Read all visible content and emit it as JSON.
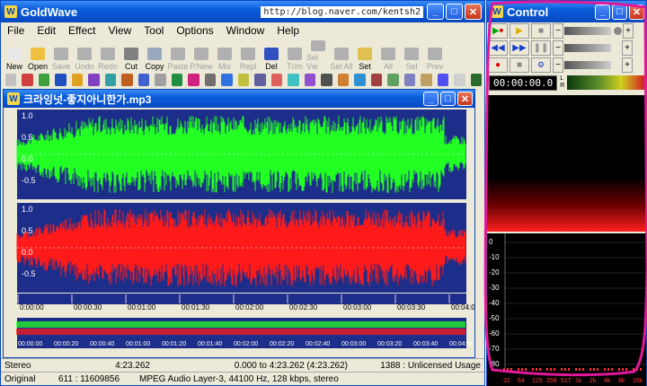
{
  "main_window": {
    "title": "GoldWave",
    "url_overlay": "http://blog.naver.com/kentsh2",
    "menu": [
      "File",
      "Edit",
      "Effect",
      "View",
      "Tool",
      "Options",
      "Window",
      "Help"
    ],
    "toolbar": [
      {
        "label": "New",
        "name": "new",
        "color": "#e8e8e8"
      },
      {
        "label": "Open",
        "name": "open",
        "color": "#f0c040"
      },
      {
        "label": "Save",
        "name": "save",
        "color": "#b0b0b0",
        "disabled": true
      },
      {
        "label": "Undo",
        "name": "undo",
        "color": "#b0b0b0",
        "disabled": true
      },
      {
        "label": "Redo",
        "name": "redo",
        "color": "#b0b0b0",
        "disabled": true
      },
      {
        "label": "Cut",
        "name": "cut",
        "color": "#808080"
      },
      {
        "label": "Copy",
        "name": "copy",
        "color": "#9aa8c0"
      },
      {
        "label": "Paste",
        "name": "paste",
        "color": "#b0b0b0",
        "disabled": true
      },
      {
        "label": "P.New",
        "name": "paste-new",
        "color": "#b0b0b0",
        "disabled": true
      },
      {
        "label": "Mix",
        "name": "mix",
        "color": "#b0b0b0",
        "disabled": true
      },
      {
        "label": "Repl",
        "name": "replace",
        "color": "#b0b0b0",
        "disabled": true
      },
      {
        "label": "Del",
        "name": "delete",
        "color": "#3050c0"
      },
      {
        "label": "Trim",
        "name": "trim",
        "color": "#b0b0b0",
        "disabled": true
      },
      {
        "label": "Sel Vw",
        "name": "select-view",
        "color": "#b0b0b0",
        "disabled": true
      },
      {
        "label": "Sel All",
        "name": "select-all",
        "color": "#b0b0b0",
        "disabled": true
      },
      {
        "label": "Set",
        "name": "set",
        "color": "#e0c050"
      },
      {
        "label": "All",
        "name": "all",
        "color": "#b0b0b0",
        "disabled": true
      },
      {
        "label": "Sel",
        "name": "sel",
        "color": "#b0b0b0",
        "disabled": true
      },
      {
        "label": "Prev",
        "name": "prev",
        "color": "#b0b0b0",
        "disabled": true
      }
    ]
  },
  "document_window": {
    "title": "크라잉넛-좋지아니한가.mp3",
    "y_ticks_top": [
      "1.0",
      "0.5",
      "0.0",
      "-0.5"
    ],
    "y_ticks_bottom": [
      "1.0",
      "0.5",
      "0.0",
      "-0.5"
    ],
    "time_ticks": [
      "0:00:00",
      "00:00:30",
      "00:01:00",
      "00:01:30",
      "00:02:00",
      "00:02:30",
      "00:03:00",
      "00:03:30",
      "00:04:00"
    ],
    "overview_ticks": [
      "00:00:00",
      "00:00:20",
      "00:00:40",
      "00:01:00",
      "00:01:20",
      "00:01:40",
      "00:02:00",
      "00:02:20",
      "00:02:40",
      "00:03:00",
      "00:03:20",
      "00:03:40",
      "00:04:00"
    ],
    "colors": {
      "left_channel": "#22ff22",
      "right_channel": "#ff1a1a",
      "background": "#1d2d8a"
    }
  },
  "status": {
    "row1": {
      "channels": "Stereo",
      "length": "4:23.262",
      "selection": "0.000 to 4:23.262 (4:23.262)",
      "license": "1388 : Unlicensed Usage"
    },
    "row2": {
      "mode": "Original",
      "position": "611 : 11609856",
      "format": "MPEG Audio Layer-3, 44100 Hz, 128 kbps, stereo"
    }
  },
  "control_window": {
    "title": "Control",
    "time_display": "00:00:00.0",
    "channel_labels": [
      "L",
      "R"
    ],
    "db_ticks": [
      "0",
      "-10",
      "-20",
      "-30",
      "-40",
      "-50",
      "-60",
      "-70",
      "-80"
    ],
    "hz_ticks": [
      "32",
      "64",
      "129",
      "258",
      "517",
      "1k",
      "2k",
      "4k",
      "8k",
      "16k"
    ],
    "speed_label": "1.0"
  },
  "annotation_color": "#e0189a"
}
